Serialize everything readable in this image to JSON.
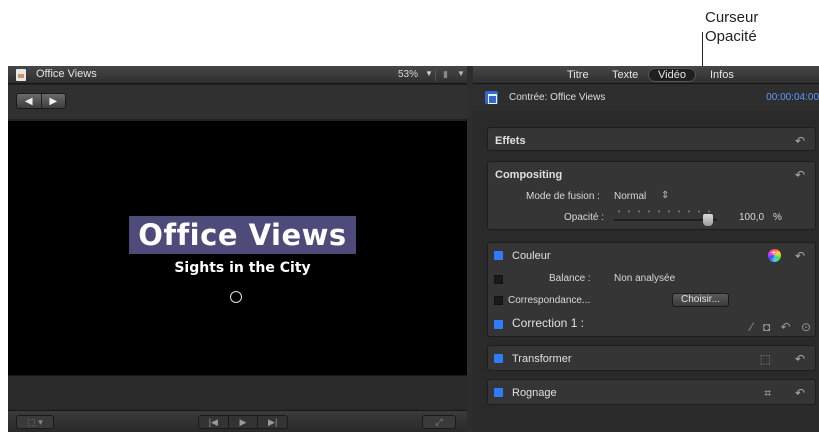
{
  "callout": {
    "line1": "Curseur",
    "line2": "Opacité"
  },
  "viewer": {
    "title": "Office Views",
    "zoom": "53%",
    "video_title": "Office Views",
    "video_subtitle": "Sights in the City"
  },
  "inspector": {
    "tabs": [
      "Titre",
      "Texte",
      "Vidéo",
      "Infos"
    ],
    "active_tab": "Vidéo",
    "clip_label": "Contrée: Office Views",
    "timecode": "00:00:04:00",
    "sections": {
      "effets": "Effets",
      "compositing": "Compositing",
      "blend_label": "Mode de fusion :",
      "blend_value": "Normal",
      "opacity_label": "Opacité :",
      "opacity_value": "100,0",
      "opacity_unit": "%",
      "couleur": "Couleur",
      "balance_label": "Balance :",
      "balance_value": "Non analysée",
      "match_label": "Correspondance...",
      "choose_button": "Choisir...",
      "correction": "Correction 1 :",
      "transformer": "Transformer",
      "rognage": "Rognage"
    }
  },
  "colors": {
    "accent": "#2f7cff",
    "timecode": "#5b9bff",
    "title_bg": "#4e4a7a"
  },
  "opacity_percent": 100
}
